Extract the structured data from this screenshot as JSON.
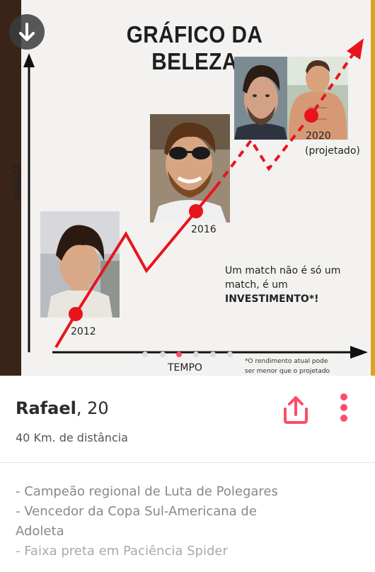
{
  "chart": {
    "title": "GRÁFICO DA BELEZA",
    "y_label": "BELEZA",
    "x_label": "TEMPO",
    "year_2012": "2012",
    "year_2016": "2016",
    "year_2020": "2020",
    "projected": "(projetado)",
    "message_1": "Um match não é só um",
    "message_2": "match, é um",
    "message_bold": "INVESTIMENTO*!",
    "footnote_1": "*O rendimento atual pode",
    "footnote_2": "ser menor que o projetado"
  },
  "chart_data": {
    "type": "line",
    "title": "GRÁFICO DA BELEZA",
    "xlabel": "TEMPO",
    "ylabel": "BELEZA",
    "x": [
      "2012",
      "2016",
      "2020"
    ],
    "series": [
      {
        "values": [
          1,
          2.5,
          4
        ]
      }
    ],
    "note": "2020 (projetado)"
  },
  "profile": {
    "name": "Rafael",
    "age_text": ", 20",
    "distance": "40 Km. de distância",
    "bio": [
      "- Campeão regional de Luta de Polegares",
      "- Vencedor da Copa Sul-Americana de",
      "Adoleta",
      "- Faixa preta em Paciência Spider"
    ]
  },
  "colors": {
    "accent": "#fd4c6a",
    "chart_red": "#e8141c"
  }
}
